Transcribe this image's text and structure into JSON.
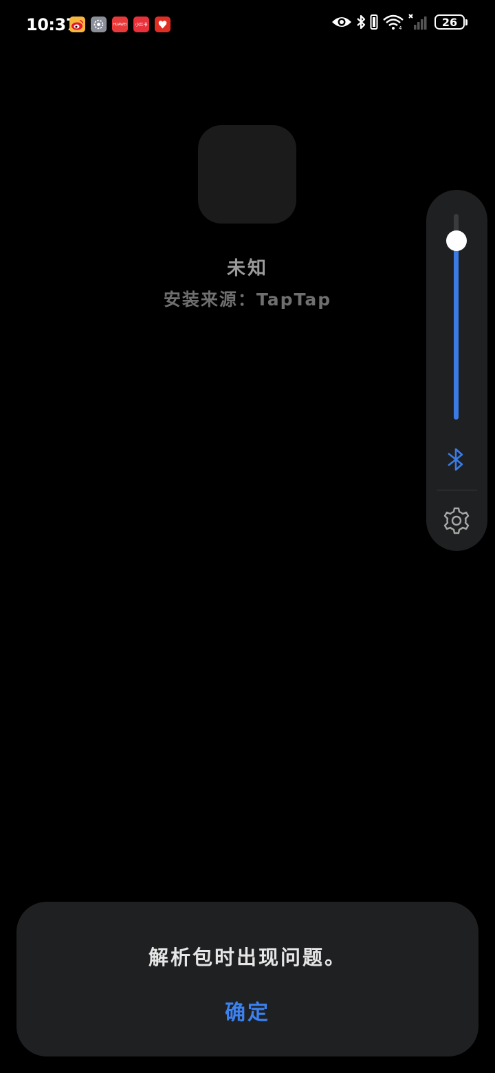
{
  "status_bar": {
    "time": "10:37",
    "battery_level": "26",
    "notifications": [
      {
        "icon": "weibo-icon",
        "label": "",
        "color": "#f5b83d"
      },
      {
        "icon": "settings-app-icon",
        "label": "",
        "color": "#8a8f9a"
      },
      {
        "icon": "vmall-icon",
        "label": "HUAWEI",
        "color": "#e83a3a"
      },
      {
        "icon": "xiaohongshu-icon",
        "label": "小红书",
        "color": "#e8313a"
      },
      {
        "icon": "pinduoduo-icon",
        "label": "",
        "color": "#e02e24"
      }
    ],
    "sys_icons": [
      "eye-comfort-icon",
      "bluetooth-icon",
      "vibrate-icon",
      "wifi-icon",
      "no-signal-icon",
      "battery-icon"
    ]
  },
  "app": {
    "name": "未知",
    "source": "安装来源：TapTap",
    "icon_color": "#1b1b1c"
  },
  "volume_panel": {
    "level": 0.87,
    "fill_color": "#3b7be6",
    "output_icon": "bluetooth-icon",
    "settings_icon": "gear-icon"
  },
  "dialog": {
    "message": "解析包时出现问题。",
    "confirm_label": "确定",
    "accent_color": "#3b82f0"
  }
}
